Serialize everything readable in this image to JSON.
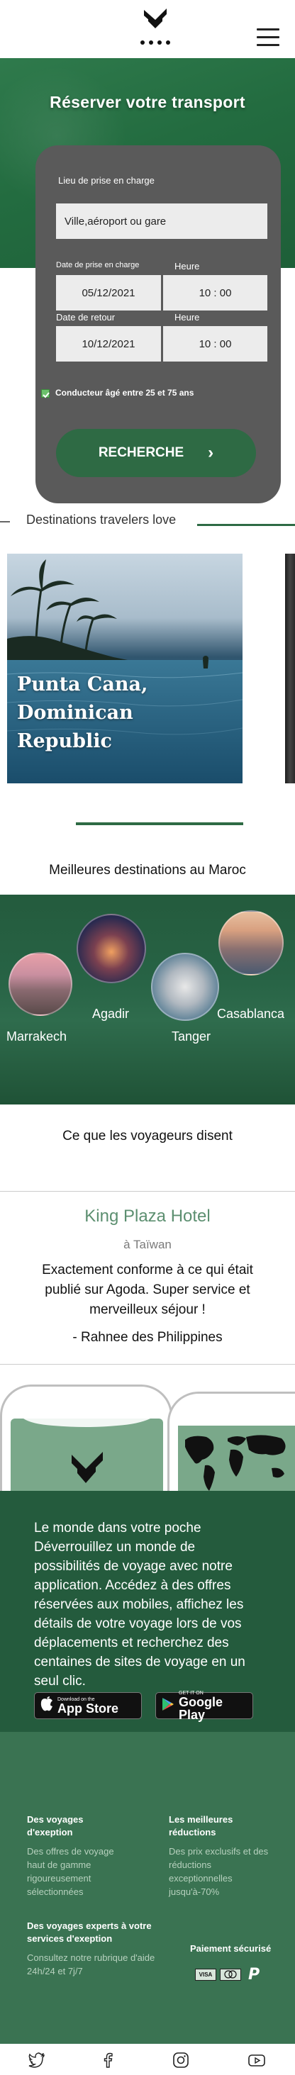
{
  "header": {
    "logo_icon": "brand-logo-icon",
    "menu_icon": "hamburger-menu-icon"
  },
  "hero": {
    "title": "Réserver votre transport"
  },
  "booking_form": {
    "pickup_label": "Lieu de prise en charge",
    "pickup_placeholder": "Ville,aéroport ou gare",
    "pickup_date_label": "Date de prise en charge",
    "pickup_time_label": "Heure",
    "pickup_date": "05/12/2021",
    "pickup_time": "10 : 00",
    "return_date_label": "Date de retour",
    "return_time_label": "Heure",
    "return_date": "10/12/2021",
    "return_time": "10 : 00",
    "age_checkbox_label": "Conducteur âgé entre 25 et 75 ans",
    "age_checked": true,
    "search_button": "RECHERCHE"
  },
  "destinations_love": {
    "title": "Destinations travelers love",
    "featured": {
      "name": "Punta Cana, Dominican Republic",
      "lines": [
        "Punta Cana,",
        "Dominican",
        "Republic"
      ]
    }
  },
  "morocco": {
    "title": "Meilleures destinations au Maroc",
    "cities": [
      "Marrakech",
      "Agadir",
      "Tanger",
      "Casablanca"
    ]
  },
  "reviews": {
    "title": "Ce que les voyageurs disent",
    "hotel": "King Plaza Hotel",
    "location": "à Taïwan",
    "quote": "Exactement conforme à ce qui était publié sur Agoda. Super service et merveilleux séjour !",
    "author": "- Rahnee des Philippines"
  },
  "app_promo": {
    "text": "Le monde dans votre poche Déverrouillez un monde de possibilités de voyage avec notre application. Accédez à des offres réservées aux mobiles, affichez les détails de votre voyage lors de vos déplacements et recherchez des centaines de sites de voyage en un seul clic.",
    "app_store_small": "Download on the",
    "app_store_big": "App Store",
    "google_play_small": "GET IT ON",
    "google_play_big": "Google Play"
  },
  "footer": {
    "col1_head": "Des voyages d'exeption",
    "col1_body": "Des offres de voyage haut de gamme rigoureusement sélectionnées",
    "col2_head": "Les meilleures réductions",
    "col2_body": "Des prix exclusifs et des réductions exceptionnelles jusqu'à-70%",
    "col3_head": "Des voyages experts à votre services d'exeption",
    "col3_body": "Consultez notre rubrique d'aide 24h/24 et 7j/7",
    "payment_head": "Paiement sécurisé",
    "payment_icons": [
      "visa-icon",
      "mastercard-icon",
      "paypal-icon"
    ],
    "visa_label": "VISA",
    "paypal_label": "P"
  },
  "social": [
    "twitter-icon",
    "facebook-icon",
    "instagram-icon",
    "youtube-icon"
  ],
  "colors": {
    "brand_green": "#245b3d",
    "button_green": "#2e6a44",
    "card_gray": "#5a5a5a",
    "footer_green": "#3a7352"
  }
}
